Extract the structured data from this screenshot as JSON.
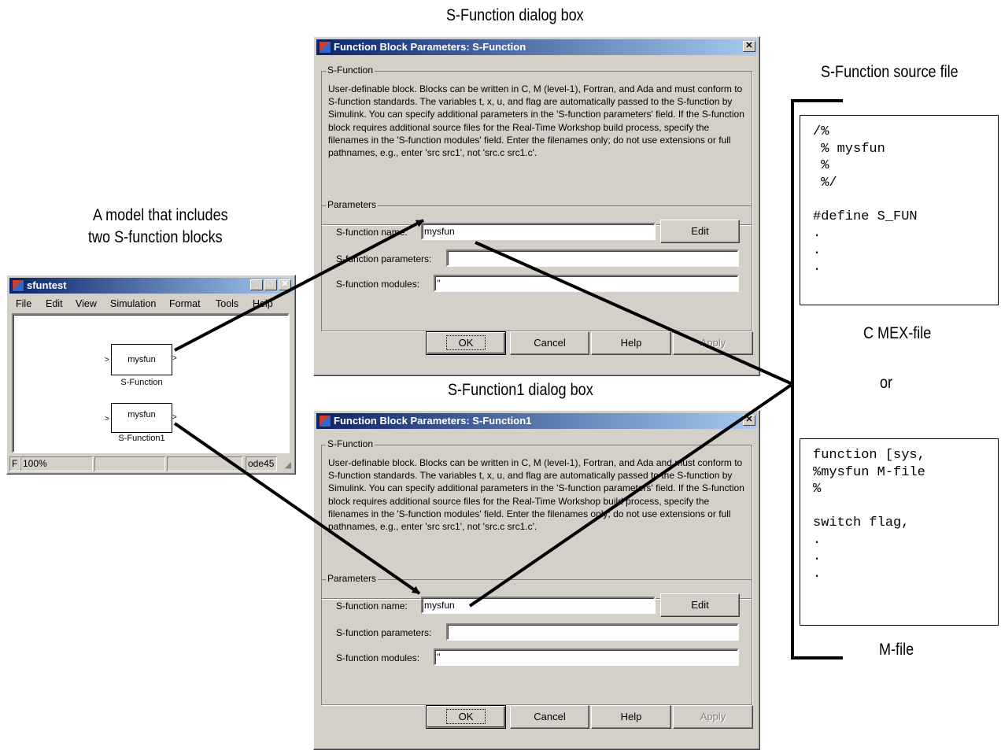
{
  "captions": {
    "dialog1": "S-Function dialog box",
    "dialog2": "S-Function1 dialog box",
    "model_line1": "A model that includes",
    "model_line2": "two S-function blocks",
    "source_file": "S-Function source file",
    "c_mex": "C MEX-file",
    "or": "or",
    "m_file": "M-file"
  },
  "dialogs": [
    {
      "title": "Function Block Parameters: S-Function",
      "close_glyph": "✕",
      "group1_label": "S-Function",
      "description": "User-definable block.  Blocks can be written in C, M (level-1), Fortran, and Ada and must conform to S-function standards.  The variables t, x, u, and flag are automatically passed to the S-function by Simulink.  You can specify additional parameters in the 'S-function parameters' field. If the S-function block requires additional source files for the Real-Time Workshop build process, specify the filenames in the 'S-function modules' field. Enter the filenames only; do not use extensions or full pathnames, e.g., enter 'src src1', not 'src.c src1.c'.",
      "group2_label": "Parameters",
      "name_label": "S-function name:",
      "name_value": "mysfun",
      "edit_button": "Edit",
      "params_label": "S-function parameters:",
      "params_value": "",
      "modules_label": "S-function modules:",
      "modules_value": "''",
      "ok": "OK",
      "cancel": "Cancel",
      "help": "Help",
      "apply": "Apply"
    },
    {
      "title": "Function Block Parameters: S-Function1",
      "close_glyph": "✕",
      "group1_label": "S-Function",
      "description": "User-definable block.  Blocks can be written in C, M (level-1), Fortran, and Ada and must conform to S-function standards.  The variables t, x, u, and flag are automatically passed to the S-function by Simulink.  You can specify additional parameters in the 'S-function parameters' field. If the S-function block requires additional source files for the Real-Time Workshop build process, specify the filenames in the 'S-function modules' field. Enter the filenames only; do not use extensions or full pathnames, e.g., enter 'src src1', not 'src.c src1.c'.",
      "group2_label": "Parameters",
      "name_label": "S-function name:",
      "name_value": "mysfun",
      "edit_button": "Edit",
      "params_label": "S-function parameters:",
      "params_value": "",
      "modules_label": "S-function modules:",
      "modules_value": "''",
      "ok": "OK",
      "cancel": "Cancel",
      "help": "Help",
      "apply": "Apply"
    }
  ],
  "model": {
    "title": "sfuntest",
    "minimize_glyph": "_",
    "maximize_glyph": "□",
    "close_glyph": "✕",
    "menu": [
      "File",
      "Edit",
      "View",
      "Simulation",
      "Format",
      "Tools",
      "Help"
    ],
    "block1_text": "mysfun",
    "block1_label": "S-Function",
    "block2_text": "mysfun",
    "block2_label": "S-Function1",
    "port_in": ">",
    "port_out": ">",
    "status": [
      "F",
      "100%",
      "",
      "",
      "ode45"
    ]
  },
  "source_c": "/%\n % mysfun\n %\n %/\n\n#define S_FUN\n.\n.\n.",
  "source_m": "function [sys,\n%mysfun M-file\n%\n\nswitch flag,\n.\n.\n."
}
